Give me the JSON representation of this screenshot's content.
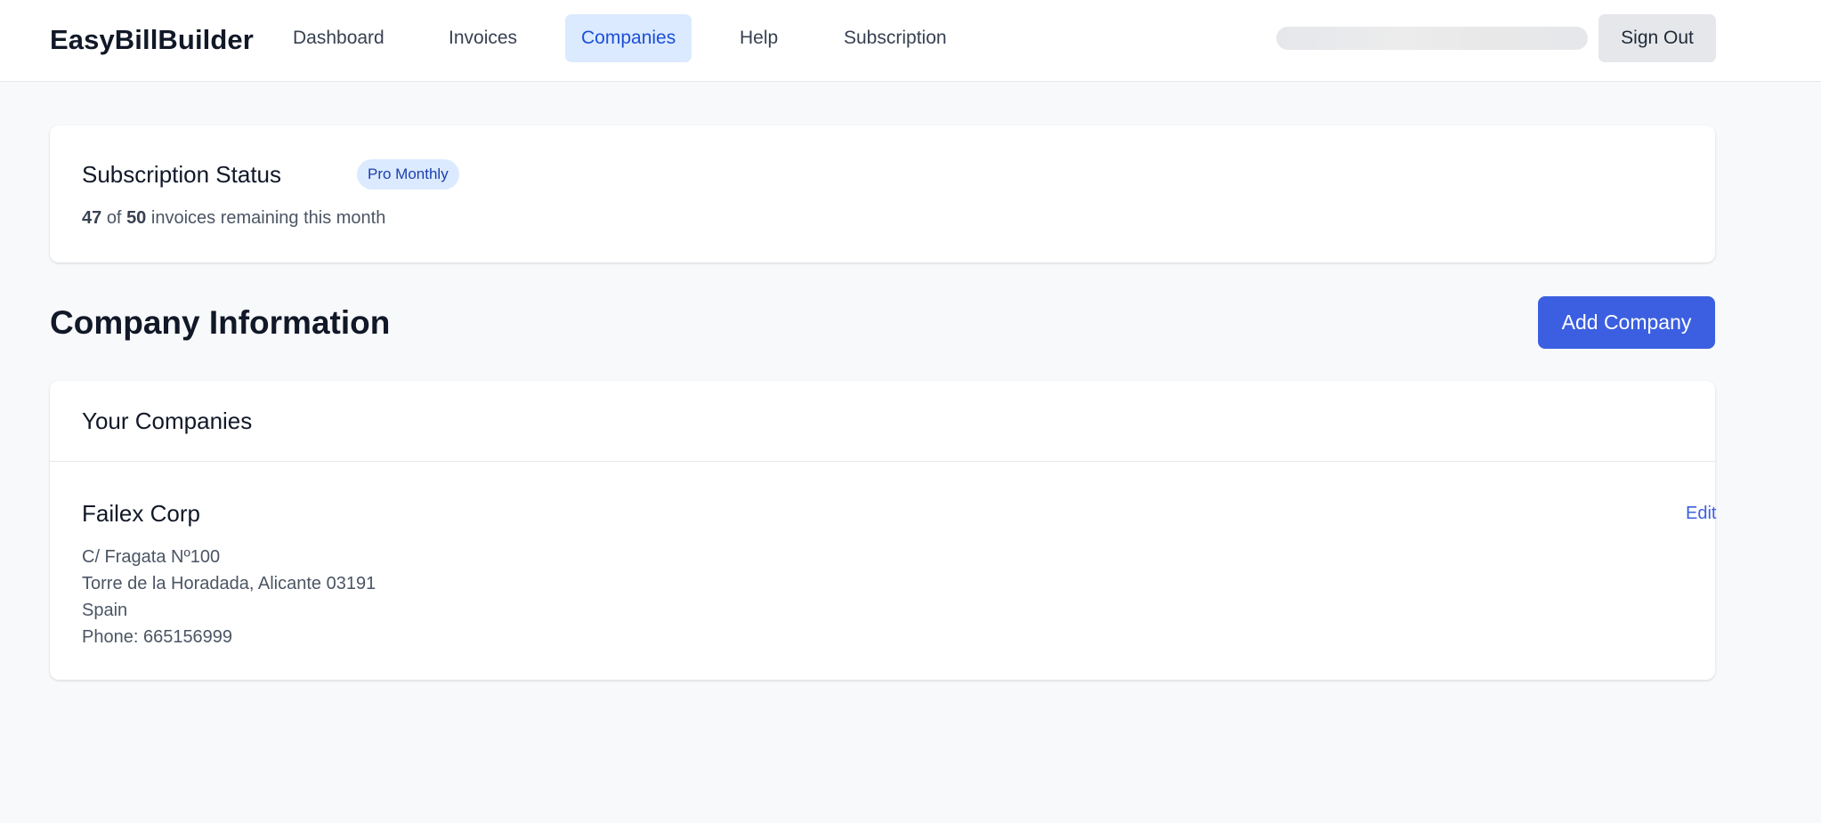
{
  "header": {
    "logo": "EasyBillBuilder",
    "nav": {
      "dashboard": "Dashboard",
      "invoices": "Invoices",
      "companies": "Companies",
      "help": "Help",
      "subscription": "Subscription"
    },
    "active_nav": "Companies",
    "sign_out": "Sign Out"
  },
  "subscription": {
    "title": "Subscription Status",
    "plan_badge": "Pro Monthly",
    "remaining": "47",
    "of_text": "of",
    "total": "50",
    "suffix": "invoices remaining this month"
  },
  "company_section": {
    "title": "Company Information",
    "add_button": "Add Company"
  },
  "companies_card": {
    "title": "Your Companies",
    "companies": [
      {
        "name": "Failex Corp",
        "edit_label": "Edit",
        "address_line1": "C/ Fragata Nº100",
        "address_line2": "Torre de la Horadada, Alicante 03191",
        "country": "Spain",
        "phone": "Phone: 665156999"
      }
    ]
  },
  "colors": {
    "primary": "#3b5fe0",
    "active_nav_bg": "#dbeafe",
    "page_bg": "#f8f9fb"
  }
}
